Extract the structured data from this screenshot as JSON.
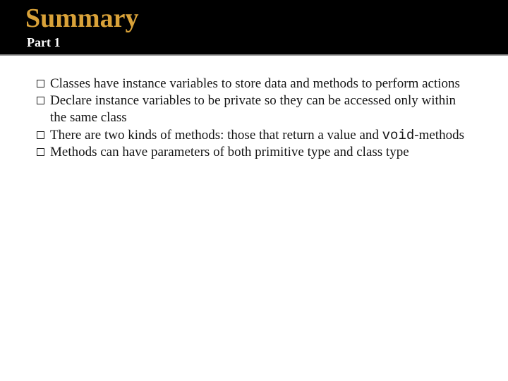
{
  "header": {
    "title": "Summary",
    "subtitle": "Part 1"
  },
  "bullets": [
    {
      "pre": "Classes have instance variables to store data and methods to perform actions",
      "code": "",
      "post": ""
    },
    {
      "pre": "Declare instance variables to be private so they can be accessed only within the same class",
      "code": "",
      "post": ""
    },
    {
      "pre": "There are two kinds of methods: those that return a value and ",
      "code": "void",
      "post": "-methods"
    },
    {
      "pre": "Methods can have parameters of both primitive type and class type",
      "code": "",
      "post": ""
    }
  ]
}
